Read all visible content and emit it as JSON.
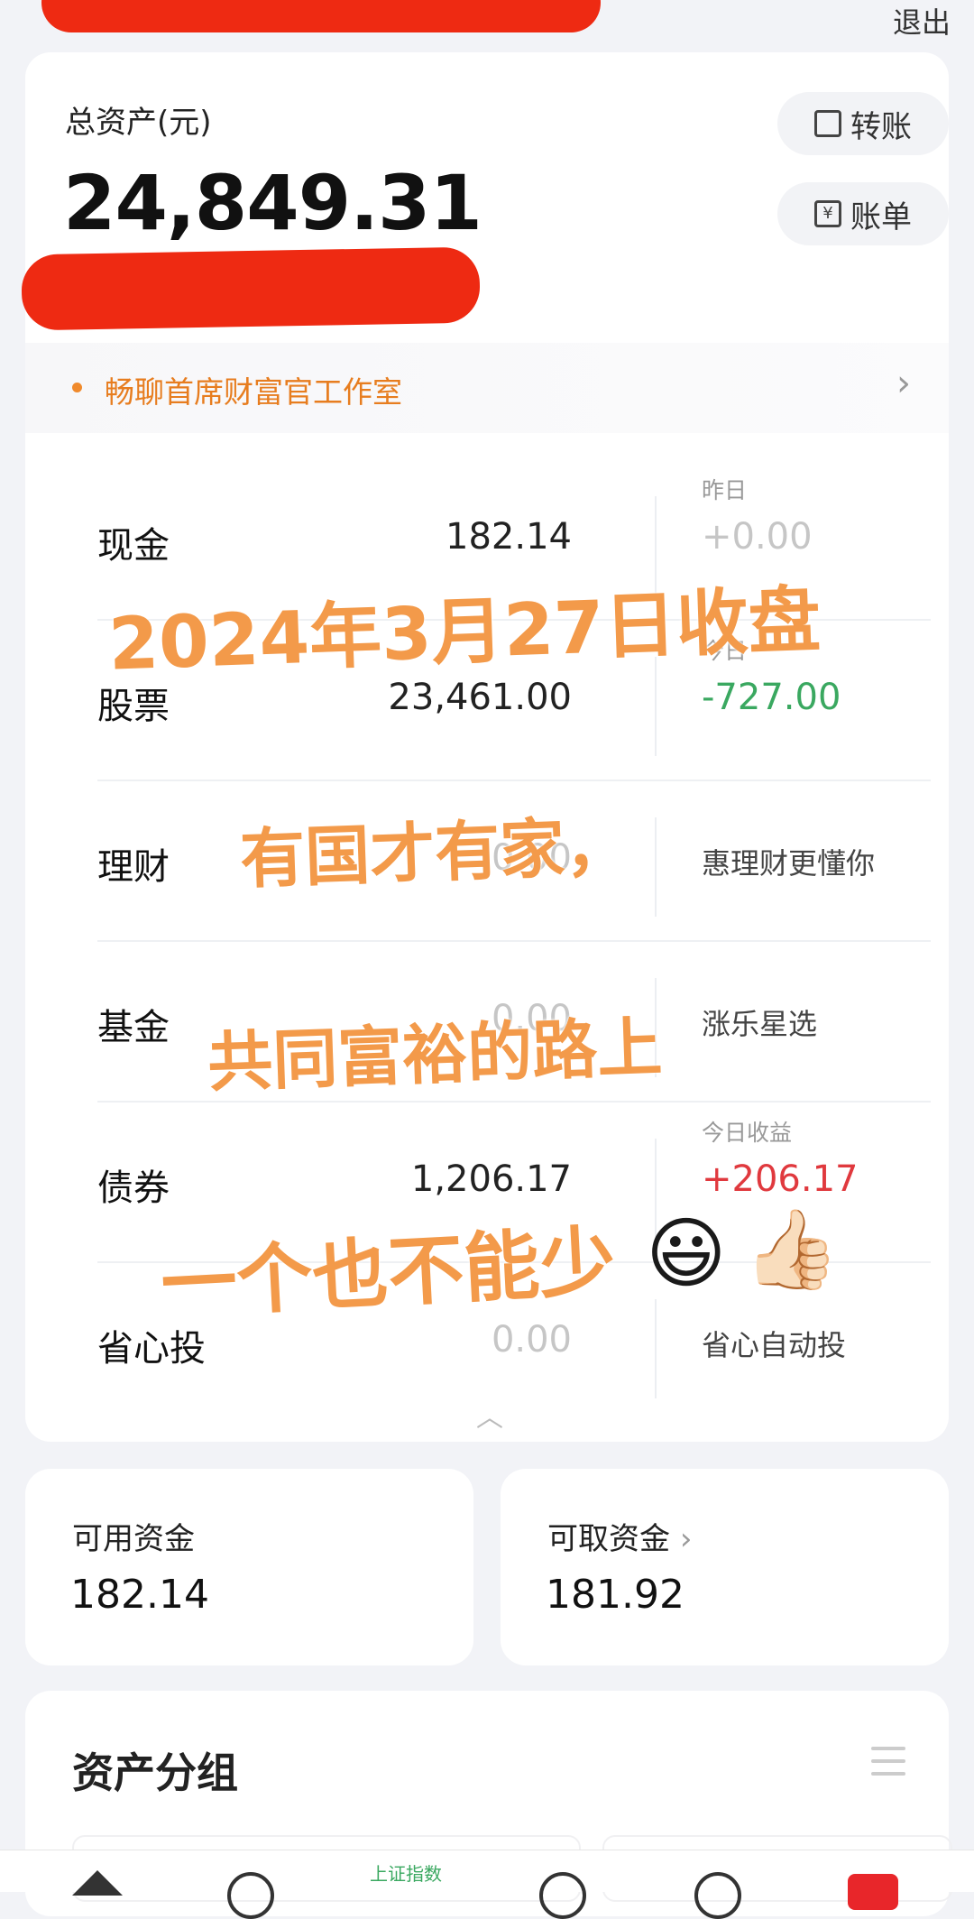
{
  "header": {
    "logout_label": "退出"
  },
  "assets": {
    "total_label": "总资产(元)",
    "total_value": "24,849.31",
    "transfer_label": "转账",
    "bill_label": "账单"
  },
  "promo": {
    "text": "畅聊首席财富官工作室"
  },
  "holdings": [
    {
      "name": "现金",
      "value": "182.14",
      "sub_label": "昨日",
      "sub_value": "+0.00"
    },
    {
      "name": "股票",
      "value": "23,461.00",
      "sub_label": "今日",
      "sub_value": "-727.00"
    },
    {
      "name": "理财",
      "value": "0.00",
      "side_text": "惠理财更懂你"
    },
    {
      "name": "基金",
      "value": "0.00",
      "side_text": "涨乐星选"
    },
    {
      "name": "债券",
      "value": "1,206.17",
      "sub_label": "今日收益",
      "sub_value": "+206.17"
    },
    {
      "name": "省心投",
      "value": "0.00",
      "side_text": "省心自动投"
    }
  ],
  "capital": {
    "available_label": "可用资金",
    "available_value": "182.14",
    "withdrawable_label": "可取资金",
    "withdrawable_value": "181.92"
  },
  "group": {
    "title": "资产分组"
  },
  "tabbar": {
    "index_label": "上证指数"
  },
  "overlay": {
    "line1": "2024年3月27日收盘",
    "line2": "有国才有家，",
    "line3": "共同富裕的路上",
    "line4": "一个也不能少",
    "emoji1": "😃",
    "emoji2": "👍🏻"
  },
  "colors": {
    "accent_orange": "#e77d1f",
    "down_green": "#3aa860",
    "up_red": "#e0393e",
    "redaction": "#ee2a12"
  }
}
